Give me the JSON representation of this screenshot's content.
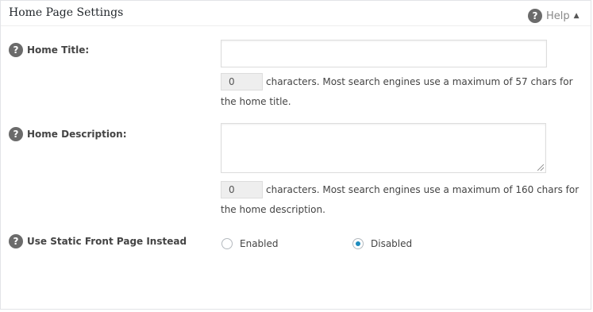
{
  "header": {
    "title": "Home Page Settings",
    "help_label": "Help",
    "help_arrow": "▲"
  },
  "fields": {
    "home_title": {
      "label": "Home Title:",
      "value": "",
      "char_count": "0",
      "hint_line1": "characters. Most search engines use a maximum of 57 chars for",
      "hint_line2": "the home title."
    },
    "home_description": {
      "label": "Home Description:",
      "value": "",
      "char_count": "0",
      "hint_line1": "characters. Most search engines use a maximum of 160 chars for",
      "hint_line2": "the home description."
    },
    "static_front_page": {
      "label": "Use Static Front Page Instead",
      "options": [
        {
          "label": "Enabled",
          "checked": false
        },
        {
          "label": "Disabled",
          "checked": true
        }
      ]
    }
  },
  "icons": {
    "help": "?"
  },
  "colors": {
    "radio_checked": "#1e8cbe",
    "help_icon_bg": "#6b6b6b"
  }
}
